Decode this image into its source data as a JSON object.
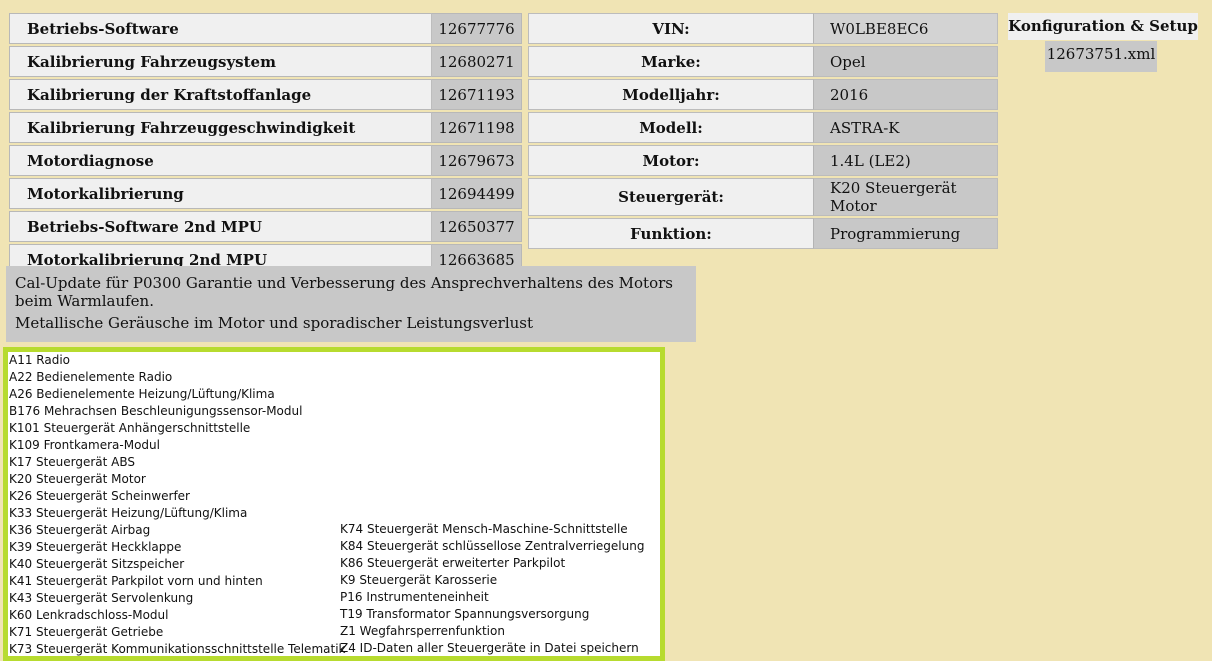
{
  "software": [
    {
      "name": "Betriebs-Software",
      "number": "12677776"
    },
    {
      "name": "Kalibrierung Fahrzeugsystem",
      "number": "12680271"
    },
    {
      "name": "Kalibrierung der Kraftstoffanlage",
      "number": "12671193"
    },
    {
      "name": "Kalibrierung Fahrzeuggeschwindigkeit",
      "number": "12671198"
    },
    {
      "name": "Motordiagnose",
      "number": "12679673"
    },
    {
      "name": "Motorkalibrierung",
      "number": "12694499"
    },
    {
      "name": "Betriebs-Software 2nd MPU",
      "number": "12650377"
    },
    {
      "name": "Motorkalibrierung 2nd MPU",
      "number": "12663685"
    }
  ],
  "vehicle": [
    {
      "label": "VIN:",
      "value": "W0LBE8EC6"
    },
    {
      "label": "Marke:",
      "value": "Opel"
    },
    {
      "label": "Modelljahr:",
      "value": "2016"
    },
    {
      "label": "Modell:",
      "value": "ASTRA-K"
    },
    {
      "label": "Motor:",
      "value": "1.4L (LE2)"
    },
    {
      "label": "Steuergerät:",
      "value": "K20 Steuergerät Motor"
    },
    {
      "label": "Funktion:",
      "value": "Programmierung"
    }
  ],
  "config": {
    "title": "Konfiguration & Setup",
    "file": "12673751.xml"
  },
  "description": {
    "line1": "Cal-Update für P0300 Garantie und Verbesserung des Ansprechverhaltens des Motors beim Warmlaufen.",
    "line2": "Metallische Geräusche im Motor und sporadischer Leistungsverlust"
  },
  "modules": {
    "left": [
      "A11 Radio",
      "A22 Bedienelemente Radio",
      "A26 Bedienelemente Heizung/Lüftung/Klima",
      "B176 Mehrachsen Beschleunigungssensor-Modul",
      "K101 Steuergerät Anhängerschnittstelle",
      "K109 Frontkamera-Modul",
      "K17 Steuergerät ABS",
      "K20 Steuergerät Motor",
      "K26 Steuergerät Scheinwerfer",
      "K33 Steuergerät Heizung/Lüftung/Klima",
      "K36 Steuergerät Airbag",
      "K39 Steuergerät Heckklappe",
      "K40 Steuergerät Sitzspeicher",
      "K41 Steuergerät Parkpilot vorn und hinten",
      "K43 Steuergerät Servolenkung",
      "K60 Lenkradschloss-Modul",
      "K71 Steuergerät Getriebe",
      "K73 Steuergerät Kommunikationsschnittstelle Telematik"
    ],
    "right": [
      "K74 Steuergerät Mensch-Maschine-Schnittstelle",
      "K84 Steuergerät schlüssellose Zentralverriegelung",
      "K86 Steuergerät erweiterter Parkpilot",
      "K9 Steuergerät Karosserie",
      "P16 Instrumenteneinheit",
      "T19 Transformator Spannungsversorgung",
      "Z1 Wegfahrsperrenfunktion",
      "Z4 ID-Daten aller Steuergeräte in Datei speichern"
    ]
  }
}
